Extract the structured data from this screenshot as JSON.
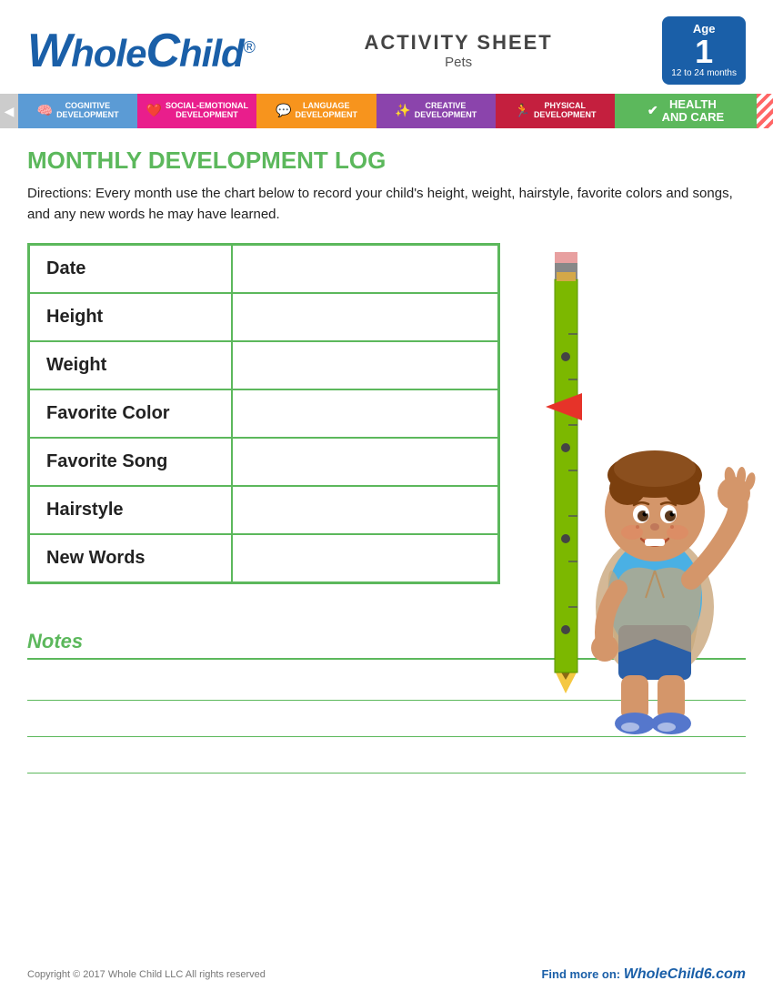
{
  "header": {
    "logo": "WholeChild",
    "registered": "®",
    "activity_sheet": "ACTIVITY SHEET",
    "subtitle": "Pets",
    "age_label": "Age",
    "age_num": "1",
    "age_range": "12 to 24 months"
  },
  "categories": [
    {
      "id": "cognitive",
      "label": "COGNITIVE\nDEVELOPMENT",
      "color": "#5b9bd5"
    },
    {
      "id": "social",
      "label": "SOCIAL-EMOTIONAL\nDEVELOPMENT",
      "color": "#e91e8c"
    },
    {
      "id": "language",
      "label": "LANGUAGE\nDEVELOPMENT",
      "color": "#f7941d"
    },
    {
      "id": "creative",
      "label": "CREATIVE\nDEVELOPMENT",
      "color": "#8b44ac"
    },
    {
      "id": "physical",
      "label": "PHYSICAL\nDEVELOPMENT",
      "color": "#c41f3e"
    },
    {
      "id": "health",
      "label": "HEALTH AND CARE",
      "color": "#5cb85c"
    }
  ],
  "main": {
    "section_title": "MONTHLY DEVELOPMENT LOG",
    "directions": "Directions: Every month use the chart below to record your child's height, weight, hairstyle, favorite colors and songs, and any new words he may have learned.",
    "table_rows": [
      {
        "label": "Date",
        "value": ""
      },
      {
        "label": "Height",
        "value": ""
      },
      {
        "label": "Weight",
        "value": ""
      },
      {
        "label": "Favorite Color",
        "value": ""
      },
      {
        "label": "Favorite Song",
        "value": ""
      },
      {
        "label": "Hairstyle",
        "value": ""
      },
      {
        "label": "New Words",
        "value": ""
      }
    ]
  },
  "notes": {
    "title": "Notes"
  },
  "footer": {
    "copyright": "Copyright © 2017 Whole Child LLC All rights reserved",
    "find_more": "Find more on:",
    "website": "WholeChild6.com"
  }
}
